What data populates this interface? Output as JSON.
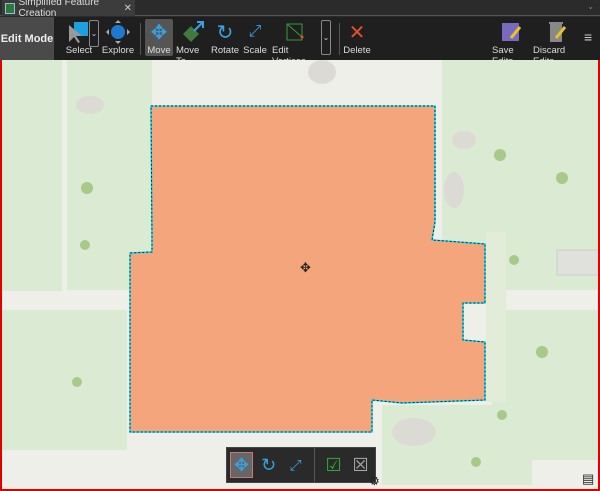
{
  "tab": {
    "title": "Simplified Feature Creation",
    "close": "✕"
  },
  "toolbar": {
    "mode": "Edit Mode",
    "tools": [
      {
        "label": "Select",
        "icon": "select-icon"
      },
      {
        "label": "Explore",
        "icon": "explore-icon"
      },
      {
        "label": "Move",
        "icon": "move-icon",
        "active": true
      },
      {
        "label": "Move To",
        "icon": "move-to-icon"
      },
      {
        "label": "Rotate",
        "icon": "rotate-icon"
      },
      {
        "label": "Scale",
        "icon": "scale-icon"
      },
      {
        "label": "Edit Vertices",
        "icon": "edit-vertices-icon"
      },
      {
        "label": "Delete",
        "icon": "delete-icon"
      },
      {
        "label": "Save Edits",
        "icon": "save-edits-icon"
      },
      {
        "label": "Discard Edits",
        "icon": "discard-edits-icon"
      }
    ]
  },
  "colors": {
    "polygon": "#f4a57c",
    "selection": "#00e5ff",
    "accent": "#3ba0e0",
    "border": "#e00000"
  }
}
